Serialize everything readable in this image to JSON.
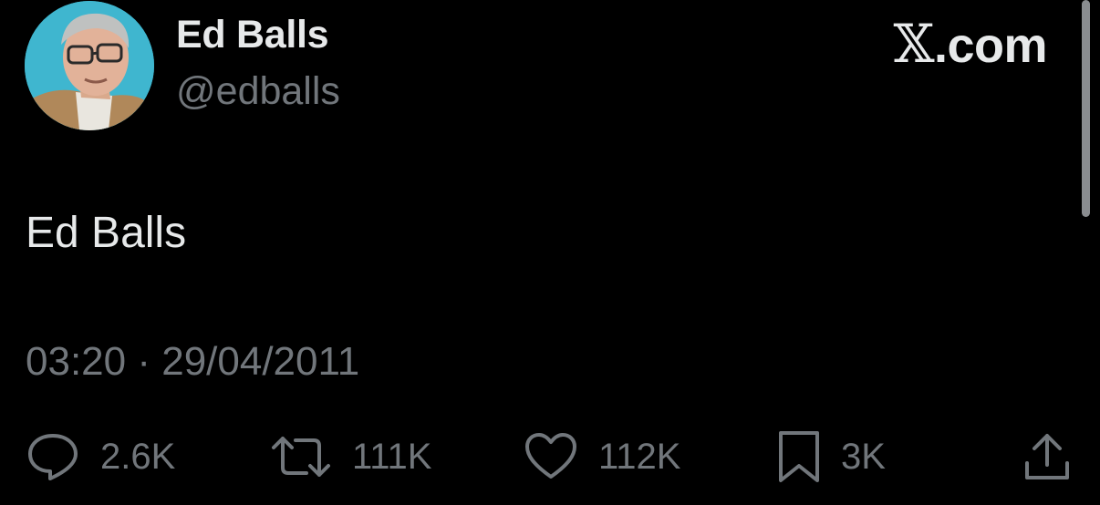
{
  "author": {
    "display_name": "Ed Balls",
    "handle": "@edballs"
  },
  "brand": {
    "x_glyph": "𝕏",
    "suffix": ".com"
  },
  "tweet": {
    "text": "Ed Balls",
    "time": "03:20",
    "separator": " · ",
    "date": "29/04/2011"
  },
  "actions": {
    "replies": "2.6K",
    "reposts": "111K",
    "likes": "112K",
    "bookmarks": "3K"
  },
  "icons": {
    "reply": "reply-bubble-icon",
    "repost": "repost-arrows-icon",
    "like": "heart-icon",
    "bookmark": "bookmark-icon",
    "share": "share-upload-icon"
  },
  "colors": {
    "background": "#000000",
    "primary_text": "#e7e9ea",
    "secondary_text": "#71767b",
    "avatar_background": "#3fb6cf"
  }
}
